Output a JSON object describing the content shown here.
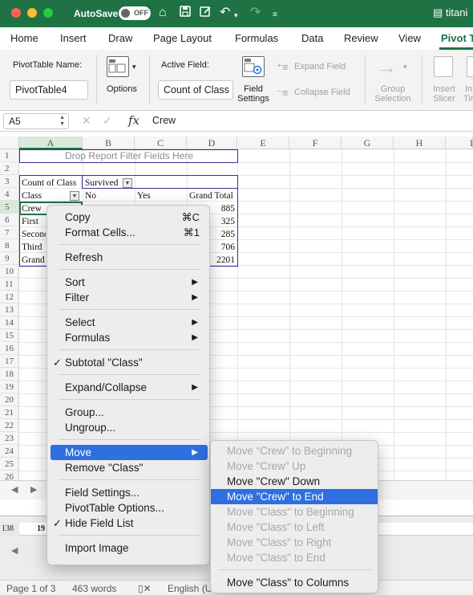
{
  "titlebar": {
    "autosave_label": "AutoSave",
    "autosave_state": "OFF",
    "document_title": "titani",
    "icons": [
      "home-icon",
      "save-icon",
      "edit-icon",
      "undo-icon",
      "redo-icon",
      "customize-toolbar-icon",
      "document-icon"
    ]
  },
  "ribbon_tabs": [
    "Home",
    "Insert",
    "Draw",
    "Page Layout",
    "Formulas",
    "Data",
    "Review",
    "View",
    "Pivot T"
  ],
  "active_tab": "Pivot T",
  "ribbon": {
    "pivot_table_name_label": "PivotTable Name:",
    "pivot_table_name_value": "PivotTable4",
    "options_label": "Options",
    "active_field_label": "Active Field:",
    "active_field_value": "Count of Class",
    "field_settings_line1": "Field",
    "field_settings_line2": "Settings",
    "expand_field": "Expand Field",
    "collapse_field": "Collapse Field",
    "group_selection_line1": "Group",
    "group_selection_line2": "Selection",
    "insert_slicer_line1": "Insert",
    "insert_slicer_line2": "Slicer",
    "insert_timeline_line1": "In",
    "insert_timeline_line2": "Tir"
  },
  "formula_bar": {
    "name_box": "A5",
    "cancel_icon": "✕",
    "confirm_icon": "✓",
    "fx_label": "fx",
    "content": "Crew"
  },
  "grid": {
    "columns": [
      "A",
      "B",
      "C",
      "D",
      "E",
      "F",
      "G",
      "H",
      "I"
    ],
    "selected_column": "A",
    "rows": [
      "1",
      "2",
      "3",
      "4",
      "5",
      "6",
      "7",
      "8",
      "9",
      "10",
      "11",
      "12",
      "13",
      "14",
      "15",
      "16",
      "17",
      "18",
      "19",
      "20",
      "21",
      "22",
      "23",
      "24",
      "25",
      "26"
    ],
    "selected_row": "5",
    "pivot": {
      "drop_filter_text": "Drop Report Filter Fields Here",
      "count_label": "Count of Class",
      "survived_label": "Survived",
      "class_label": "Class",
      "no_label": "No",
      "yes_label": "Yes",
      "grand_total_label": "Grand Total",
      "row_labels": [
        "Crew",
        "First",
        "Second",
        "Third",
        "Grand"
      ],
      "grand_totals": [
        "885",
        "325",
        "285",
        "706",
        "2201"
      ]
    }
  },
  "lower_window": {
    "row_number": "138",
    "cell_value": "19"
  },
  "status_bar": {
    "page": "Page 1 of 3",
    "words": "463 words",
    "language": "English (U"
  },
  "context_menu": {
    "copy": "Copy",
    "copy_shortcut": "⌘C",
    "format_cells": "Format Cells...",
    "format_cells_shortcut": "⌘1",
    "refresh": "Refresh",
    "sort": "Sort",
    "filter": "Filter",
    "select": "Select",
    "formulas": "Formulas",
    "subtotal_class": "Subtotal \"Class\"",
    "expand_collapse": "Expand/Collapse",
    "group": "Group...",
    "ungroup": "Ungroup...",
    "move": "Move",
    "remove_class": "Remove \"Class\"",
    "field_settings": "Field Settings...",
    "pivottable_options": "PivotTable Options...",
    "hide_field_list": "Hide Field List",
    "import_image": "Import Image"
  },
  "move_submenu": {
    "to_beginning": "Move “Crew” to Beginning",
    "up": "Move “Crew” Up",
    "down": "Move \"Crew\" Down",
    "to_end": "Move \"Crew\" to End",
    "class_to_beginning": "Move \"Class\" to Beginning",
    "class_to_left": "Move \"Class\" to Left",
    "class_to_right": "Move \"Class\" to Right",
    "class_to_end": "Move \"Class\" to End",
    "class_to_columns": "Move \"Class\" to Columns"
  }
}
